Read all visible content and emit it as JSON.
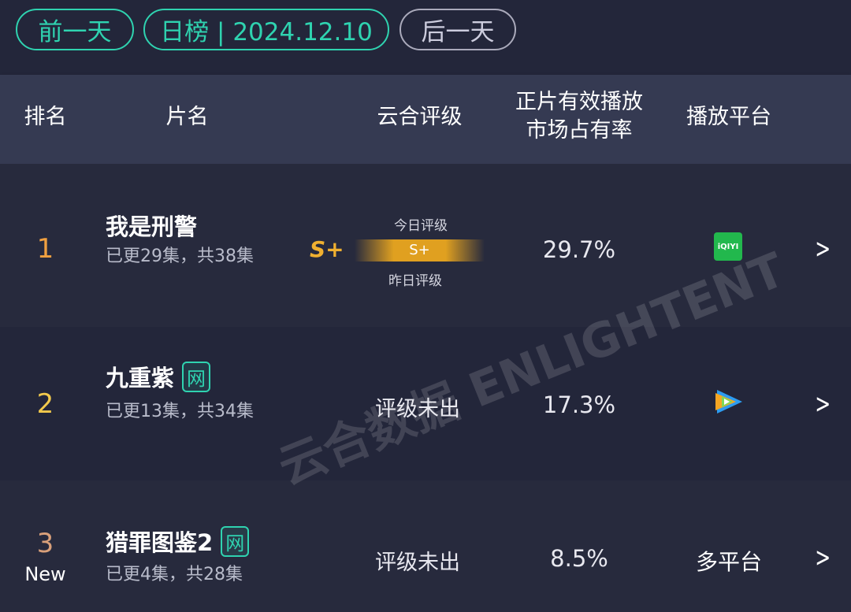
{
  "nav": {
    "prev": "前一天",
    "current": "日榜 | 2024.12.10",
    "next": "后一天"
  },
  "header": {
    "rank": "排名",
    "title": "片名",
    "rating": "云合评级",
    "share_line1": "正片有效播放",
    "share_line2": "市场占有率",
    "platform": "播放平台"
  },
  "rows": [
    {
      "rank": "1",
      "rank_color": "#f0a040",
      "title": "我是刑警",
      "episodes": "已更29集，共38集",
      "rating": "S+",
      "today_label": "今日评级",
      "yesterday_label": "昨日评级",
      "bar_rating": "S+",
      "share": "29.7%",
      "platform": "iQIYI",
      "platform_icon": "iqiyi-icon"
    },
    {
      "rank": "2",
      "rank_color": "#f2c94c",
      "title": "九重紫",
      "badge": "网",
      "episodes": "已更13集，共34集",
      "rating": "评级未出",
      "share": "17.3%",
      "platform_icon": "tencent-video-icon"
    },
    {
      "rank": "3",
      "rank_color": "#d9a07a",
      "new_label": "New",
      "title": "猎罪图鉴2",
      "badge": "网",
      "episodes": "已更4集，共28集",
      "rating": "评级未出",
      "share": "8.5%",
      "platform": "多平台"
    }
  ],
  "watermark": "云合数据 ENLIGHTENT",
  "colors": {
    "accent": "#2fd3b0",
    "gold": "#f0b030"
  }
}
